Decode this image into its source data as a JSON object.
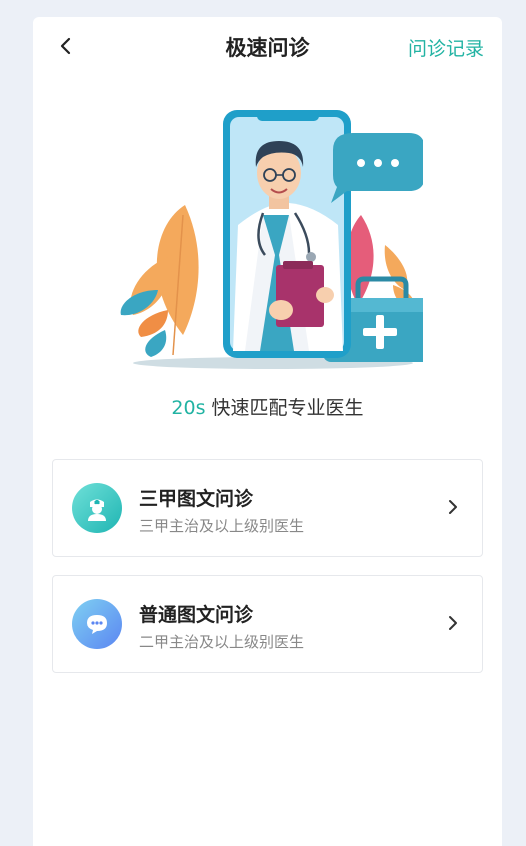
{
  "header": {
    "back_icon": "chevron-left-icon",
    "title": "极速问诊",
    "record_label": "问诊记录"
  },
  "hero": {
    "illustration": "doctor-phone-illustration",
    "tagline_accent": "20s",
    "tagline_text": "快速匹配专业医生"
  },
  "options": [
    {
      "icon": "nurse-icon",
      "title": "三甲图文问诊",
      "subtitle": "三甲主治及以上级别医生"
    },
    {
      "icon": "chat-bubble-icon",
      "title": "普通图文问诊",
      "subtitle": "二甲主治及以上级别医生"
    }
  ],
  "colors": {
    "accent": "#22b3a3",
    "background": "#ecf0f7"
  }
}
